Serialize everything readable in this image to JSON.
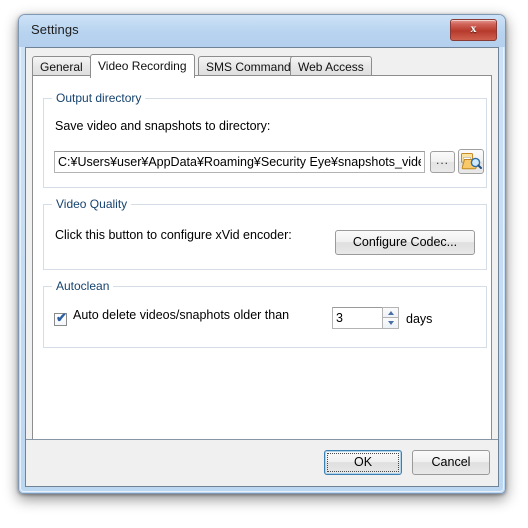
{
  "window": {
    "title": "Settings",
    "close_label": "x",
    "close_icon": "close-icon"
  },
  "tabs": [
    {
      "label": "General",
      "selected": false
    },
    {
      "label": "Video Recording",
      "selected": true
    },
    {
      "label": "SMS Commands",
      "selected": false
    },
    {
      "label": "Web Access",
      "selected": false
    }
  ],
  "output_directory": {
    "group_title": "Output directory",
    "label": "Save video and snapshots to directory:",
    "path_value": "C:¥Users¥user¥AppData¥Roaming¥Security Eye¥snapshots_video",
    "path_placeholder": "",
    "browse_label": "...",
    "open_folder_icon": "folder-search-icon"
  },
  "video_quality": {
    "group_title": "Video Quality",
    "label": "Click this button to configure xVid encoder:",
    "configure_button": "Configure Codec..."
  },
  "autoclean": {
    "group_title": "Autoclean",
    "checkbox_label": "Auto delete videos/snaphots  older than",
    "checkbox_checked": true,
    "check_glyph": "✔",
    "days_value": "3",
    "days_unit": "days",
    "spin_up_icon": "chevron-up-icon",
    "spin_down_icon": "chevron-down-icon"
  },
  "footer": {
    "ok_label": "OK",
    "cancel_label": "Cancel"
  },
  "colors": {
    "titlebar": "#b8d3ef",
    "close_button": "#b63a2c",
    "accent_focus": "#3c7fb1",
    "group_title_text": "#16436e",
    "check_blue": "#2d5fa5"
  }
}
